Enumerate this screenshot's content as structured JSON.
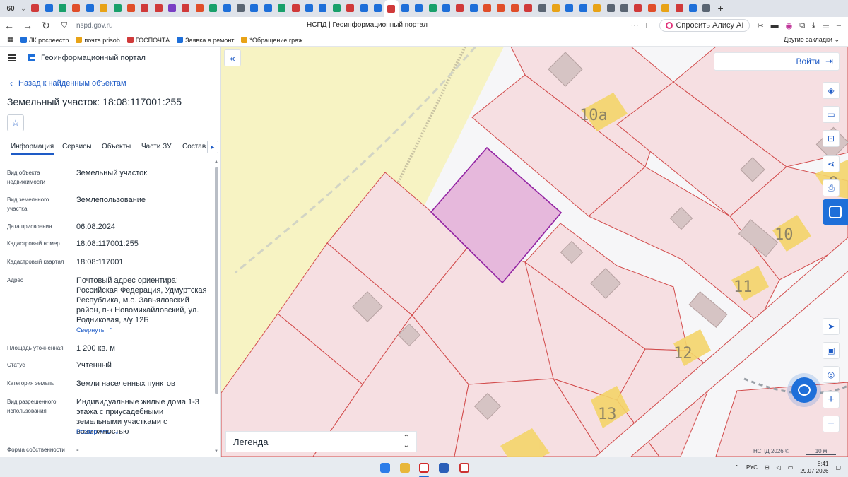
{
  "browser": {
    "tab_count": "60",
    "tab_favicon_colors": [
      "#d03a3a",
      "#1e6fd9",
      "#19a06b",
      "#e04e2a",
      "#1e6fd9",
      "#e8a317",
      "#19a06b",
      "#e04e2a",
      "#d03a3a",
      "#d03a3a",
      "#7a3fc4",
      "#d03a3a",
      "#e04e2a",
      "#19a06b",
      "#1e6fd9",
      "#5a6573",
      "#1e6fd9",
      "#1e6fd9",
      "#19a06b",
      "#d03a3a",
      "#1e6fd9",
      "#1e6fd9",
      "#19a06b",
      "#d03a3a",
      "#1e6fd9",
      "#1e6fd9",
      "#d03a3a",
      "#1e6fd9",
      "#1e6fd9",
      "#19a06b",
      "#1e6fd9",
      "#d03a3a",
      "#1e6fd9",
      "#e04e2a",
      "#e04e2a",
      "#e04e2a",
      "#d03a3a",
      "#5a6573",
      "#e8a317",
      "#1e6fd9",
      "#1e6fd9",
      "#e8a317",
      "#5a6573",
      "#5a6573",
      "#d03a3a",
      "#e04e2a",
      "#e8a317",
      "#d03a3a",
      "#1e6fd9",
      "#5a6573"
    ],
    "active_tab_index": 26,
    "url": "nspd.gov.ru",
    "page_title": "НСПД | Геоинформационный портал",
    "alice_button": "Спросить Алису AI",
    "bookmarks": [
      {
        "label": "ЛК росреестр",
        "color": "#1e6fd9"
      },
      {
        "label": "почта prisob",
        "color": "#e8a317"
      },
      {
        "label": "ГОСПОЧТА",
        "color": "#d03a3a"
      },
      {
        "label": "Заявка в ремонт",
        "color": "#1e6fd9"
      },
      {
        "label": "*Обращение граж",
        "color": "#e8a317"
      }
    ],
    "other_bookmarks": "Другие закладки"
  },
  "portal": {
    "name": "Геоинформационный портал",
    "back_link": "Назад к найденным объектам",
    "object_title": "Земельный участок: 18:08:117001:255",
    "tabs": [
      "Информация",
      "Сервисы",
      "Объекты",
      "Части ЗУ",
      "Состав"
    ],
    "active_tab": "Информация",
    "attributes": [
      {
        "label": "Вид объекта недвижимости",
        "value": "Земельный участок"
      },
      {
        "label": "Вид земельного участка",
        "value": "Землепользование"
      },
      {
        "label": "Дата присвоения",
        "value": "06.08.2024"
      },
      {
        "label": "Кадастровый номер",
        "value": "18:08:117001:255"
      },
      {
        "label": "Кадастровый квартал",
        "value": "18:08:117001"
      },
      {
        "label": "Адрес",
        "value": "Почтовый адрес ориентира: Российская Федерация, Удмуртская Республика, м.о. Завьяловский район, п-к Новомихайловский, ул. Родниковая, з/у 12Б",
        "toggle": "Свернуть"
      },
      {
        "label": "Площадь уточненная",
        "value": "1 200 кв. м"
      },
      {
        "label": "Статус",
        "value": "Учтенный"
      },
      {
        "label": "Категория земель",
        "value": "Земли населенных пунктов"
      },
      {
        "label": "Вид разрешенного использования",
        "value": "Индивидуальные жилые дома 1-3 этажа с приусадебными земельными участками с возможностью",
        "toggle": "Развернуть"
      },
      {
        "label": "Форма собственности",
        "value": "-"
      }
    ]
  },
  "map": {
    "login": "Войти",
    "legend": "Легенда",
    "copyright": "НСПД 2026 ©",
    "scale": "10 м",
    "house_numbers": [
      "10а",
      "9",
      "10",
      "11",
      "12",
      "13"
    ],
    "colors": {
      "parcel_fill": "#f6dfe2",
      "parcel_line": "#d24b4b",
      "selected_fill": "#e6b8dc",
      "selected_line": "#9324a3",
      "forest": "#f7f3c3",
      "accent": "#1e6fd9"
    }
  },
  "taskbar": {
    "language": "РУС",
    "time": "8:41",
    "date": "29.07.2026"
  }
}
